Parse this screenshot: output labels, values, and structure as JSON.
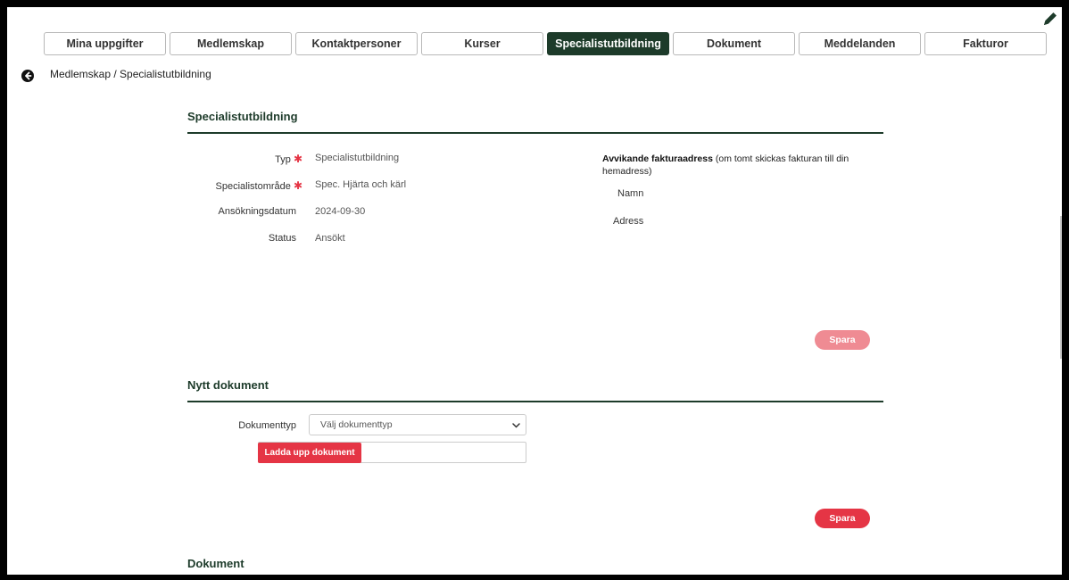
{
  "tabs": [
    {
      "label": "Mina uppgifter",
      "active": false
    },
    {
      "label": "Medlemskap",
      "active": false
    },
    {
      "label": "Kontaktpersoner",
      "active": false
    },
    {
      "label": "Kurser",
      "active": false
    },
    {
      "label": "Specialistutbildning",
      "active": true
    },
    {
      "label": "Dokument",
      "active": false
    },
    {
      "label": "Meddelanden",
      "active": false
    },
    {
      "label": "Fakturor",
      "active": false
    }
  ],
  "breadcrumb": "Medlemskap / Specialistutbildning",
  "section1": {
    "title": "Specialistutbildning",
    "fields": {
      "type_label": "Typ",
      "type_value": "Specialistutbildning",
      "area_label": "Specialistområde",
      "area_value": "Spec. Hjärta och kärl",
      "date_label": "Ansökningsdatum",
      "date_value": "2024-09-30",
      "status_label": "Status",
      "status_value": "Ansökt"
    },
    "invoice": {
      "heading_bold": "Avvikande fakturaadress",
      "heading_rest": " (om tomt skickas fakturan till din hemadress)",
      "name_label": "Namn",
      "address_label": "Adress"
    },
    "save_label": "Spara"
  },
  "section2": {
    "title": "Nytt dokument",
    "doctype_label": "Dokumenttyp",
    "doctype_selected": "Välj dokumenttyp",
    "upload_label": "Ladda upp dokument",
    "save_label": "Spara"
  },
  "section3": {
    "title": "Dokument"
  },
  "icons": {
    "edit": "pencil-icon",
    "back": "arrow-left-circle-icon",
    "dropdown": "chevron-down-icon"
  },
  "colors": {
    "brand_dark_green": "#1d3b2a",
    "accent_red": "#e53545",
    "disabled_red": "#ef8b93"
  }
}
